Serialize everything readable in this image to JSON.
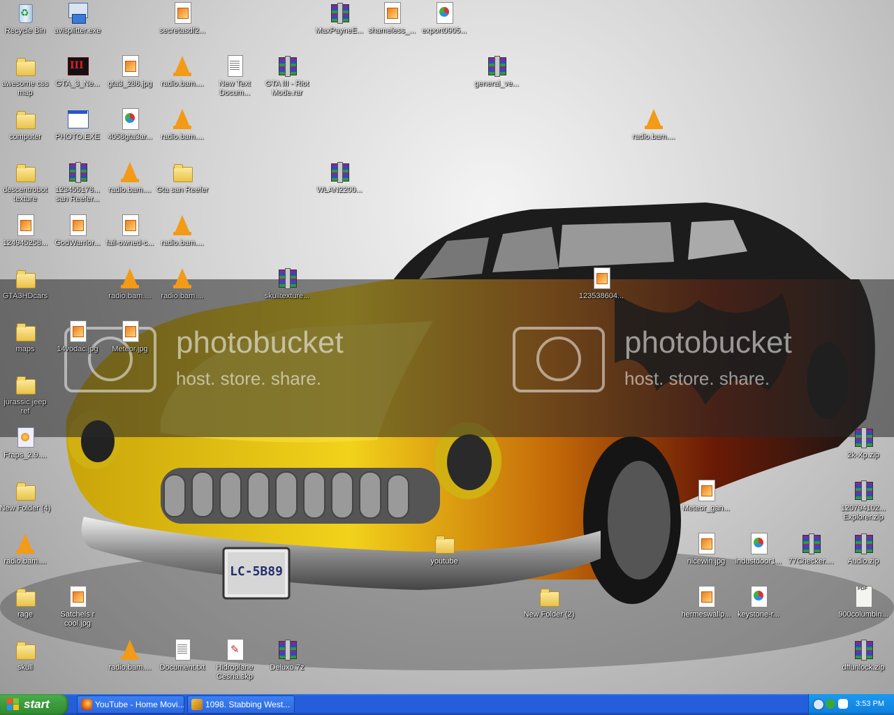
{
  "desktop": {
    "icons": [
      {
        "label": "Recycle Bin",
        "type": "recycle"
      },
      {
        "label": "avisplitter.exe",
        "type": "setup"
      },
      {
        "label": "secretasdf2...",
        "type": "jpg"
      },
      {
        "label": "MaxPayneE...",
        "type": "rar"
      },
      {
        "label": "shameless_...",
        "type": "jpg"
      },
      {
        "label": "export0905...",
        "type": "gif"
      },
      {
        "label": "awesome css map",
        "type": "folder"
      },
      {
        "label": "GTA_3_Ne...",
        "type": "gta"
      },
      {
        "label": "gta3_286.jpg",
        "type": "jpg"
      },
      {
        "label": "radio.bam....",
        "type": "vlc"
      },
      {
        "label": "New Text Docum...",
        "type": "txt"
      },
      {
        "label": "GTA III - Riot Mode.rar",
        "type": "rar"
      },
      {
        "label": "general_ve...",
        "type": "rar"
      },
      {
        "label": "computer",
        "type": "folder"
      },
      {
        "label": "PHOTO.EXE",
        "type": "exe"
      },
      {
        "label": "4058gta3ar...",
        "type": "gif"
      },
      {
        "label": "radio.bam....",
        "type": "vlc"
      },
      {
        "label": "radio.bam....",
        "type": "vlc"
      },
      {
        "label": "descentrobot texture",
        "type": "folder"
      },
      {
        "label": "123455176... san Reefer...",
        "type": "rar"
      },
      {
        "label": "radio.bam....",
        "type": "vlc"
      },
      {
        "label": "Gta san Reefer",
        "type": "folder"
      },
      {
        "label": "WLAN2200...",
        "type": "rar"
      },
      {
        "label": "124945258...",
        "type": "jpg"
      },
      {
        "label": "GodWarrior...",
        "type": "jpg"
      },
      {
        "label": "fail-owned-c...",
        "type": "jpg"
      },
      {
        "label": "radio.bam....",
        "type": "vlc"
      },
      {
        "label": "GTA3HDcars",
        "type": "folder"
      },
      {
        "label": "radio.bam....",
        "type": "vlc"
      },
      {
        "label": "radio.bam....",
        "type": "vlc"
      },
      {
        "label": "skulltexture...",
        "type": "rar"
      },
      {
        "label": "123538604...",
        "type": "jpg"
      },
      {
        "label": "maps",
        "type": "folder"
      },
      {
        "label": "14vodac.jpg",
        "type": "jpg"
      },
      {
        "label": "Meteor.jpg",
        "type": "jpg"
      },
      {
        "label": "jurassic jeep ref",
        "type": "folder"
      },
      {
        "label": "Fraps_2.9....",
        "type": "fraps"
      },
      {
        "label": "2k-Xp.zip",
        "type": "zip"
      },
      {
        "label": "New Folder (4)",
        "type": "folder"
      },
      {
        "label": "Meteor_gan...",
        "type": "jpg"
      },
      {
        "label": "120794102... Explorer.zip",
        "type": "zip"
      },
      {
        "label": "radio.bam....",
        "type": "vlc"
      },
      {
        "label": "youtube",
        "type": "folder"
      },
      {
        "label": "nicewin.jpg",
        "type": "jpg"
      },
      {
        "label": "industdoor1...",
        "type": "gif"
      },
      {
        "label": "77Checker....",
        "type": "rar"
      },
      {
        "label": "Audio.zip",
        "type": "zip"
      },
      {
        "label": "rage",
        "type": "folder"
      },
      {
        "label": "Satchels r cool.jpg",
        "type": "jpg"
      },
      {
        "label": "New Folder (2)",
        "type": "folder"
      },
      {
        "label": "hermeswallp...",
        "type": "jpg"
      },
      {
        "label": "keystone-r...",
        "type": "gif"
      },
      {
        "label": "900columbin...",
        "type": "pdf"
      },
      {
        "label": "skull",
        "type": "folder"
      },
      {
        "label": "radio.bam....",
        "type": "vlc"
      },
      {
        "label": "Document.txt",
        "type": "txt"
      },
      {
        "label": "Hidroplane Cesna.skp",
        "type": "skp"
      },
      {
        "label": "Deluxo.7z",
        "type": "rar"
      },
      {
        "label": "dffunlock.zip",
        "type": "zip"
      }
    ],
    "watermark": {
      "brand": "photobucket",
      "tagline": "host. store. share."
    },
    "plate": "LC-5B89"
  },
  "taskbar": {
    "start_label": "start",
    "tasks": [
      {
        "label": "YouTube - Home Movi..."
      },
      {
        "label": "1098. Stabbing West..."
      }
    ],
    "clock": "3:53 PM"
  }
}
